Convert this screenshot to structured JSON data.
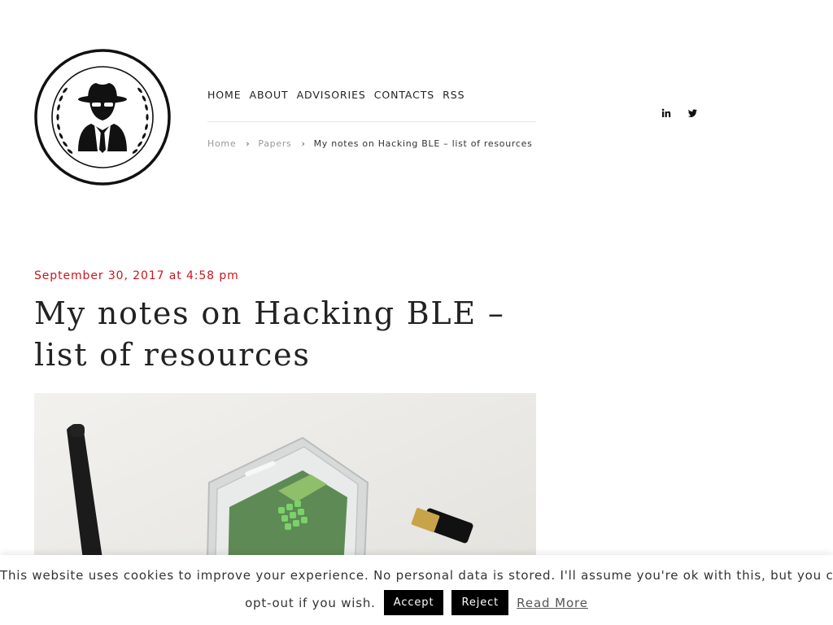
{
  "nav": {
    "items": [
      {
        "label": "HOME"
      },
      {
        "label": "ABOUT"
      },
      {
        "label": "ADVISORIES"
      },
      {
        "label": "CONTACTS"
      },
      {
        "label": "RSS"
      }
    ]
  },
  "breadcrumb": {
    "home": "Home",
    "section": "Papers",
    "separator": "›",
    "current": "My notes on Hacking BLE – list of resources"
  },
  "social": {
    "icons": [
      "linkedin-icon",
      "twitter-icon"
    ]
  },
  "post": {
    "date": "September 30, 2017 at 4:58 pm",
    "title": "My notes on Hacking BLE – list of resources"
  },
  "cookie": {
    "message_line1": "This website uses cookies to improve your experience. No personal data is stored. I'll assume you're ok with this, but you can",
    "message_line2": "opt-out if you wish.",
    "accept_label": "Accept",
    "reject_label": "Reject",
    "read_more_label": "Read More"
  },
  "colors": {
    "accent": "#c8161d",
    "button_bg": "#000000"
  }
}
